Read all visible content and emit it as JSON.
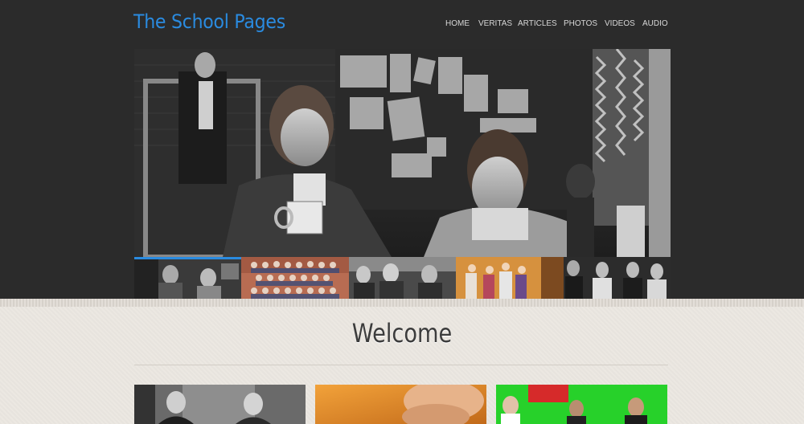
{
  "site": {
    "title": "The School Pages"
  },
  "nav": {
    "items": [
      {
        "label": "HOME"
      },
      {
        "label": "VERITAS"
      },
      {
        "label": "ARTICLES"
      },
      {
        "label": "PHOTOS"
      },
      {
        "label": "VIDEOS"
      },
      {
        "label": "AUDIO"
      }
    ]
  },
  "colors": {
    "accent": "#2a8be0",
    "header_bg": "#2b2b2b",
    "content_bg": "#ebe7e1"
  },
  "slider": {
    "active_index": 0,
    "thumbnails": [
      {
        "name": "students-in-classroom"
      },
      {
        "name": "class-group-photo"
      },
      {
        "name": "boys-smiling"
      },
      {
        "name": "girls-group-color"
      },
      {
        "name": "boys-in-suits"
      }
    ]
  },
  "main": {
    "heading": "Welcome"
  },
  "cards": [
    {
      "name": "bw-students-photo"
    },
    {
      "name": "orange-closeup-photo"
    },
    {
      "name": "greenscreen-photo"
    }
  ]
}
